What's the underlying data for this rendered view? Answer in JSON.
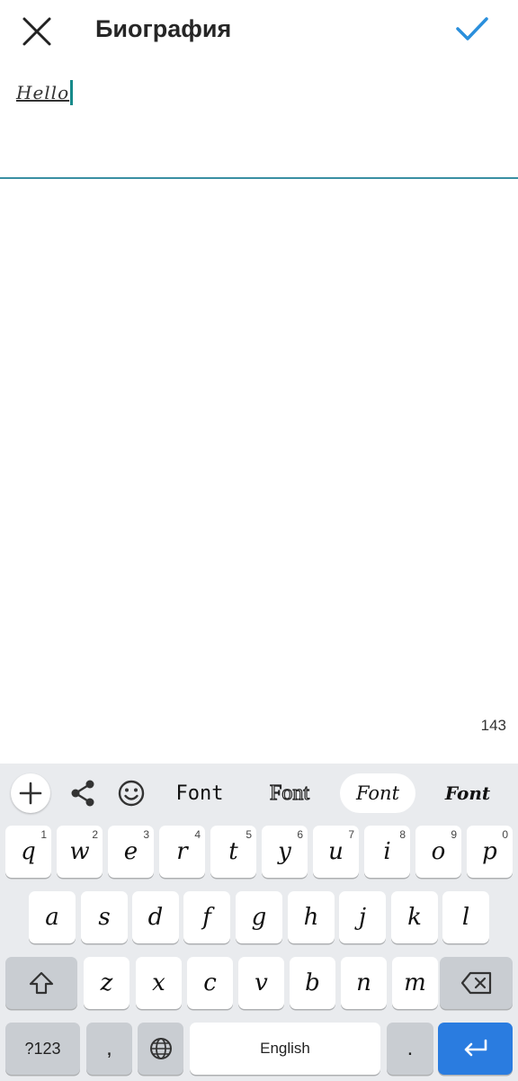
{
  "header": {
    "title": "Биография",
    "close_icon": "close-icon",
    "confirm_icon": "check-icon"
  },
  "editor": {
    "text": "Hello",
    "counter": "143"
  },
  "colors": {
    "accent": "#2a8fdc",
    "caret": "#178a8a",
    "underline": "#3a8fa3",
    "keyboard_bg": "#e9ebee",
    "enter_key": "#2a7ce0"
  },
  "keyboard": {
    "toolbar": {
      "icons": [
        "plus-icon",
        "share-icon",
        "emoji-icon"
      ],
      "fonts": [
        "Font",
        "Font",
        "Font",
        "Font"
      ]
    },
    "rows": [
      [
        {
          "k": "q",
          "h": "1"
        },
        {
          "k": "w",
          "h": "2"
        },
        {
          "k": "e",
          "h": "3"
        },
        {
          "k": "r",
          "h": "4"
        },
        {
          "k": "t",
          "h": "5"
        },
        {
          "k": "y",
          "h": "6"
        },
        {
          "k": "u",
          "h": "7"
        },
        {
          "k": "i",
          "h": "8"
        },
        {
          "k": "o",
          "h": "9"
        },
        {
          "k": "p",
          "h": "0"
        }
      ],
      [
        {
          "k": "a"
        },
        {
          "k": "s"
        },
        {
          "k": "d"
        },
        {
          "k": "f"
        },
        {
          "k": "g"
        },
        {
          "k": "h"
        },
        {
          "k": "j"
        },
        {
          "k": "k"
        },
        {
          "k": "l"
        }
      ],
      [
        {
          "k": "z"
        },
        {
          "k": "x"
        },
        {
          "k": "c"
        },
        {
          "k": "v"
        },
        {
          "k": "b"
        },
        {
          "k": "n"
        },
        {
          "k": "m"
        }
      ]
    ],
    "bottom": {
      "symbols": "?123",
      "comma": ",",
      "globe_icon": "globe-icon",
      "space": "English",
      "period": ".",
      "enter_icon": "enter-icon",
      "shift_icon": "shift-icon",
      "backspace_icon": "backspace-icon"
    }
  }
}
